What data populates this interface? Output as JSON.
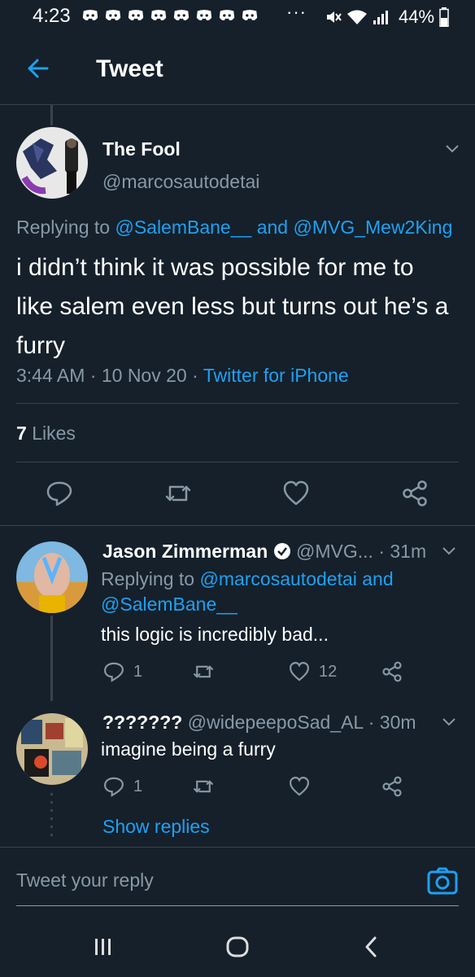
{
  "status_bar": {
    "time": "4:23",
    "notification_icons": [
      "discord-icon",
      "discord-icon",
      "discord-icon",
      "discord-icon",
      "discord-icon",
      "discord-icon",
      "discord-icon",
      "discord-icon"
    ],
    "more": "···",
    "battery": "44%"
  },
  "header": {
    "title": "Tweet"
  },
  "main_tweet": {
    "name": "The Fool",
    "handle": "@marcosautodetai",
    "replying_prefix": "Replying to",
    "replying_user1": "@SalemBane__",
    "replying_and": "and",
    "replying_user2": "@MVG_Mew2King",
    "text": "i didn’t think it was possible for me to like salem even less but turns out he’s a furry",
    "time": "3:44 AM",
    "sep": "·",
    "date": "10 Nov 20",
    "source": "Twitter for iPhone",
    "likes_count": "7",
    "likes_label": "Likes"
  },
  "replies": [
    {
      "name": "Jason Zimmerman",
      "handle": "@MVG...",
      "time": "· 31m",
      "replying_prefix": "Replying to",
      "replying_user1": "@marcosautodetai",
      "replying_and": "and",
      "replying_user2": "@SalemBane__",
      "text": "this logic is incredibly bad...",
      "reply_count": "1",
      "like_count": "12"
    },
    {
      "name": "???????",
      "handle": "@widepeepoSad_AL",
      "time": "· 30m",
      "text": "imagine being a furry",
      "reply_count": "1",
      "like_count": ""
    }
  ],
  "show_replies": "Show replies",
  "compose": {
    "placeholder": "Tweet your reply"
  },
  "colors": {
    "background": "#15202b",
    "accent": "#1da1f2",
    "muted": "#8899a6",
    "divider": "#38444d"
  }
}
